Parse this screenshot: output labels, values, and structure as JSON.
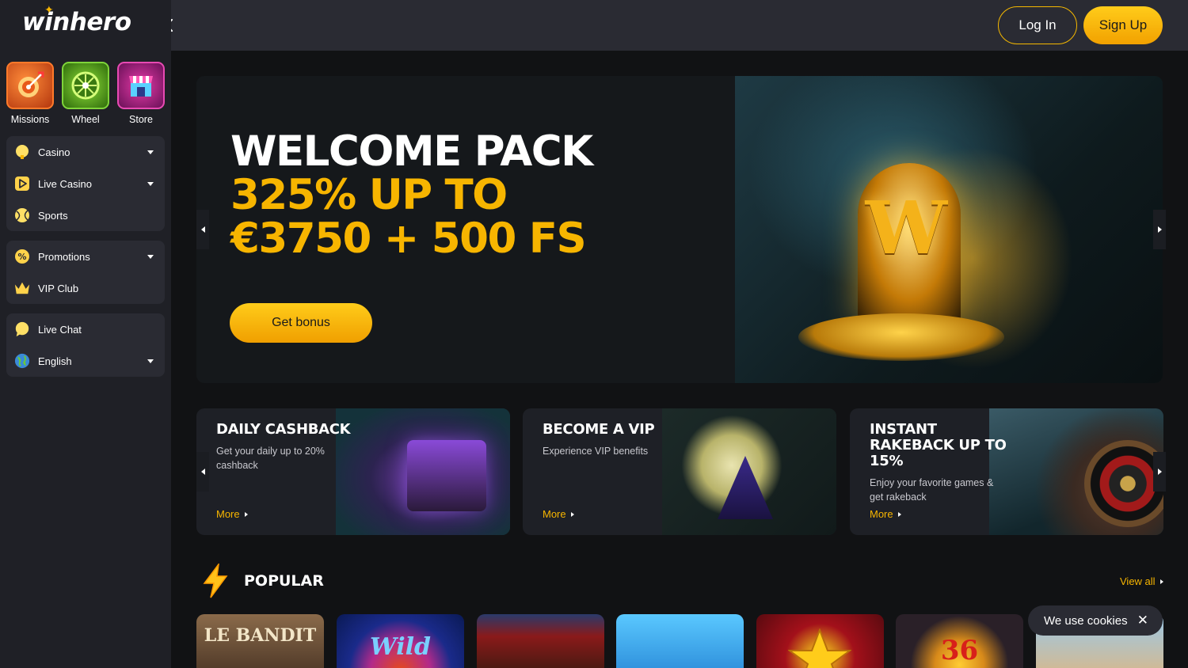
{
  "brand": {
    "logo_text": "winhero",
    "accent": "#f7b500"
  },
  "header": {
    "login_label": "Log In",
    "signup_label": "Sign Up",
    "back_icon": "chevron-left-icon"
  },
  "quick_links": [
    {
      "label": "Missions",
      "icon": "dart-target-icon"
    },
    {
      "label": "Wheel",
      "icon": "wheel-icon"
    },
    {
      "label": "Store",
      "icon": "store-icon"
    }
  ],
  "nav": {
    "group1": [
      {
        "label": "Casino",
        "icon": "casino-icon",
        "has_dropdown": true
      },
      {
        "label": "Live Casino",
        "icon": "play-icon",
        "has_dropdown": true
      },
      {
        "label": "Sports",
        "icon": "ball-icon",
        "has_dropdown": false
      }
    ],
    "group2": [
      {
        "label": "Promotions",
        "icon": "percent-icon",
        "has_dropdown": true
      },
      {
        "label": "VIP Club",
        "icon": "crown-icon",
        "has_dropdown": false
      }
    ],
    "group3": [
      {
        "label": "Live Chat",
        "icon": "chat-icon",
        "has_dropdown": false
      },
      {
        "label": "English",
        "icon": "globe-icon",
        "has_dropdown": true
      }
    ]
  },
  "hero": {
    "line1": "WELCOME PACK",
    "line2": "325% UP TO",
    "line3": "€3750 + 500 FS",
    "button_label": "Get bonus",
    "art_letter": "W"
  },
  "promos": [
    {
      "title": "DAILY CASHBACK",
      "text": "Get your daily up to 20% cashback",
      "more": "More"
    },
    {
      "title": "BECOME A VIP",
      "text": "Experience VIP benefits",
      "more": "More"
    },
    {
      "title": "INSTANT RAKEBACK UP TO 15%",
      "text": "Enjoy your favorite games & get rakeback",
      "more": "More"
    }
  ],
  "popular": {
    "title": "POPULAR",
    "view_all": "View all",
    "games": [
      {
        "title": "LE BANDIT"
      },
      {
        "title": "Wild"
      },
      {
        "title": ""
      },
      {
        "title": ""
      },
      {
        "title": ""
      },
      {
        "title": "36"
      },
      {
        "title": ""
      }
    ]
  },
  "cookie": {
    "text": "We use cookies",
    "close": "✕"
  }
}
